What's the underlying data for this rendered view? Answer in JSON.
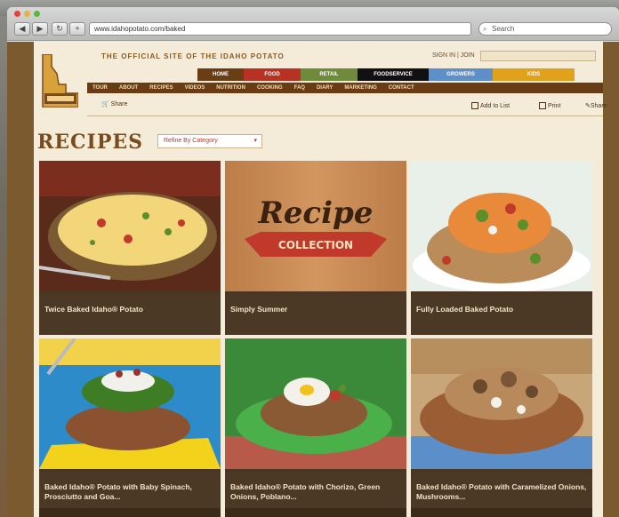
{
  "browser": {
    "url": "www.idahopotato.com/baked",
    "search_placeholder": "Search",
    "back_label": "◀",
    "forward_label": "▶",
    "reload_label": "↻",
    "plus_label": "+"
  },
  "site": {
    "tagline": "THE OFFICIAL SITE OF THE IDAHO POTATO",
    "signin": "SIGN IN | JOIN",
    "site_search": "",
    "audience_tabs": [
      {
        "label": "HOME",
        "color": "#6b3d15"
      },
      {
        "label": "FOOD",
        "color": "#b83224"
      },
      {
        "label": "RETAIL",
        "color": "#6f8a3a"
      },
      {
        "label": "FOODSERVICE",
        "color": "#111111"
      },
      {
        "label": "GROWERS",
        "color": "#5f8fc9"
      },
      {
        "label": "KIDS",
        "color": "#e0a21a"
      }
    ],
    "main_nav": [
      "TOUR",
      "ABOUT",
      "RECIPES",
      "VIDEOS",
      "NUTRITION",
      "COOKING",
      "FAQ",
      "DIARY",
      "MARKETING",
      "CONTACT"
    ],
    "share_label": "Share",
    "tools": [
      "Add to List",
      "Print",
      "Share"
    ]
  },
  "page": {
    "title": "RECIPES",
    "filter_label": "Refine By Category"
  },
  "recipes": [
    {
      "title": "Twice Baked Idaho® Potato"
    },
    {
      "title": "Simply Summer"
    },
    {
      "title": "Fully Loaded Baked Potato"
    },
    {
      "title": "Baked Idaho® Potato with Baby Spinach, Prosciutto and Goa..."
    },
    {
      "title": "Baked Idaho® Potato with Chorizo, Green Onions, Poblano..."
    },
    {
      "title": "Baked Idaho® Potato with Caramelized Onions, Mushrooms..."
    }
  ],
  "collection_art": {
    "script": "Recipe",
    "ribbon": "COLLECTION"
  },
  "colors": {
    "page_bg": "#f4ecd8",
    "brand_brown": "#7a4b1d",
    "caption_bg": "#4c3925"
  }
}
